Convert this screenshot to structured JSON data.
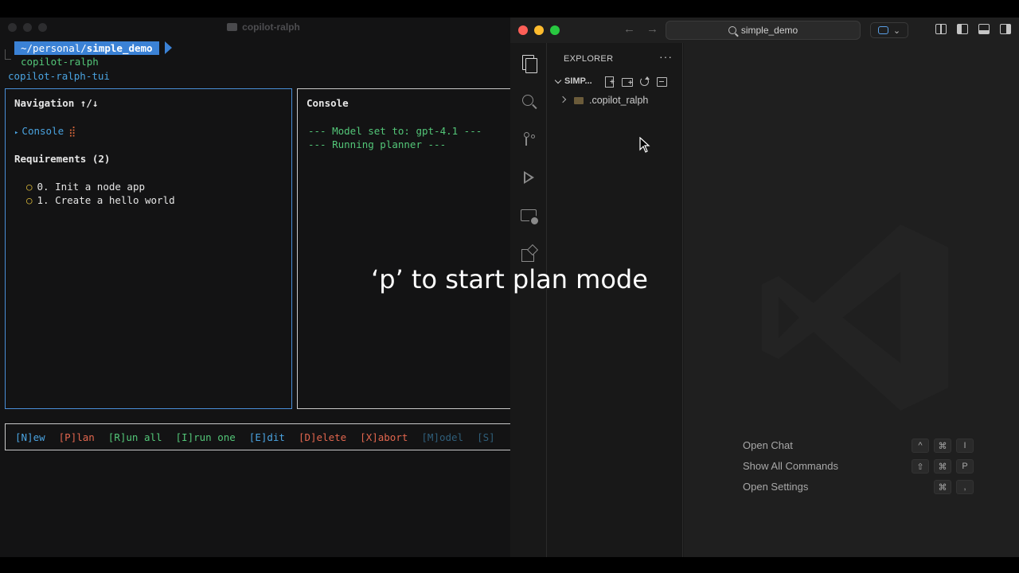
{
  "terminal": {
    "window_title": "copilot-ralph",
    "prompt_path_prefix": "~/personal/",
    "prompt_path_bold": "simple_demo",
    "command_line": "copilot-ralph",
    "output_line": "copilot-ralph-tui",
    "navigation": {
      "title": "Navigation ↑/↓",
      "console_item": "Console",
      "requirements_title": "Requirements (2)",
      "requirements": [
        {
          "label": "0. Init a node app"
        },
        {
          "label": "1. Create a hello world"
        }
      ]
    },
    "console": {
      "title": "Console",
      "lines": [
        "--- Model set to: gpt-4.1 ---",
        "--- Running planner ---"
      ]
    },
    "footer": {
      "new": "[N]ew",
      "plan": "[P]lan",
      "run_all": "[R]un all",
      "run_one": "[I]run one",
      "edit": "[E]dit",
      "delete": "[D]elete",
      "abort": "[X]abort",
      "model": "[M]odel",
      "s": "[S]"
    }
  },
  "vscode": {
    "search_text": "simple_demo",
    "explorer_title": "EXPLORER",
    "more_label": "···",
    "section_name": "SIMP...",
    "tree": [
      {
        "label": ".copilot_ralph"
      }
    ],
    "shortcuts": [
      {
        "label": "Open Chat",
        "keys": [
          "^",
          "⌘",
          "I"
        ]
      },
      {
        "label": "Show All Commands",
        "keys": [
          "⇧",
          "⌘",
          "P"
        ]
      },
      {
        "label": "Open Settings",
        "keys": [
          "⌘",
          ","
        ]
      }
    ]
  },
  "caption": "‘p’ to start plan mode",
  "colors": {
    "accent_blue": "#3b82d6",
    "terminal_green": "#53c678",
    "terminal_red": "#e2664e",
    "vscode_bg": "#181818"
  }
}
